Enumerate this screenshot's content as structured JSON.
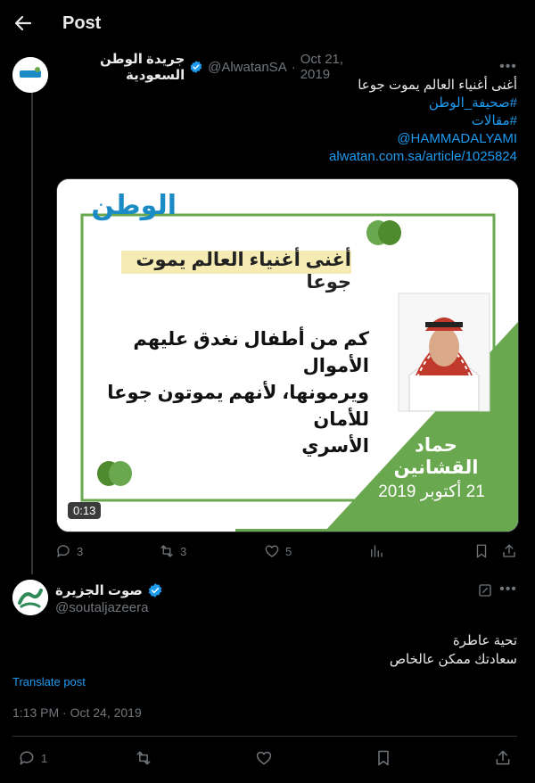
{
  "header": {
    "title": "Post"
  },
  "tweet1": {
    "author_name": "جريدة الوطن السعودية",
    "handle": "@AlwatanSA",
    "dot": "·",
    "date": "Oct 21, 2019",
    "avatar_logo_text": "الوطن",
    "lines": [
      "أغنى أغنياء العالم يموت جوعا",
      "#صحيفة_الوطن",
      "#مقالات",
      "@HAMMADALYAMI",
      "alwatan.com.sa/article/1025824"
    ],
    "media": {
      "logo_text": "الوطن",
      "headline": "أغنى أغنياء العالم يموت جوعا",
      "quote_lines": [
        "كم من أطفال نغدق عليهم الأموال",
        "ويرمونها، لأنهم يموتون جوعا للأمان",
        "الأسري"
      ],
      "author": "حماد القشانين",
      "date": "21 أكتوبر 2019",
      "duration": "0:13",
      "colors": {
        "green": "#6aa84f",
        "accent_blue": "#1b8bc6",
        "dark_green": "#4f8a2e",
        "highlight": "#f6ecb3"
      }
    },
    "actions": {
      "replies": "3",
      "reposts": "3",
      "likes": "5"
    }
  },
  "tweet2": {
    "author_name": "صوت الجزيرة",
    "handle": "@soutaljazeera",
    "lines": [
      "تحية عاطرة",
      "سعادتك ممكن عالخاص"
    ],
    "translate_label": "Translate post",
    "timestamp": "1:13 PM · Oct 24, 2019",
    "actions": {
      "replies": "1"
    }
  },
  "colors": {
    "accent": "#1d9bf0",
    "muted": "#71767b",
    "background": "#000000"
  }
}
